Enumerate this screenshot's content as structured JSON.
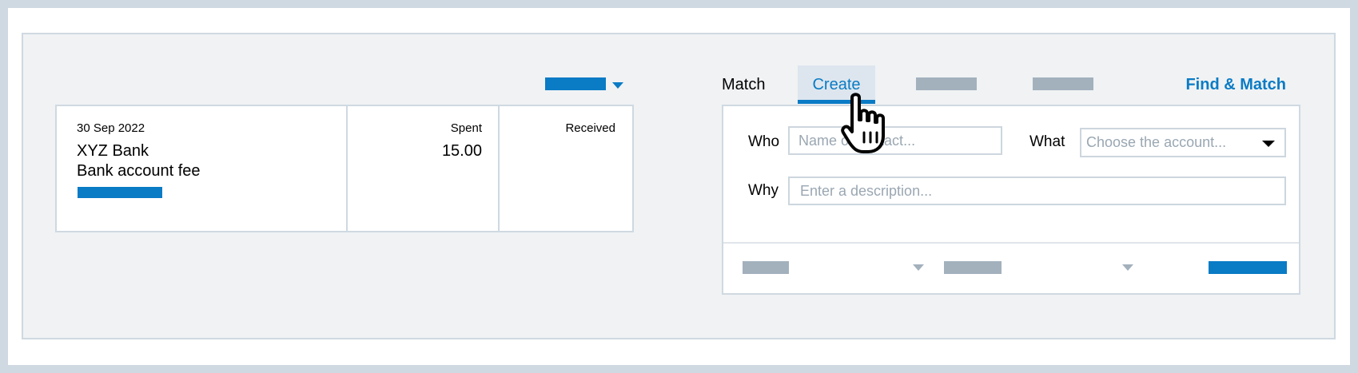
{
  "statement": {
    "date": "30 Sep 2022",
    "payee": "XYZ Bank",
    "reference": "Bank account fee",
    "spent_header": "Spent",
    "spent_value": "15.00",
    "received_header": "Received"
  },
  "tabs": {
    "match": "Match",
    "create": "Create",
    "find_match": "Find & Match",
    "active": "Create"
  },
  "form": {
    "who_label": "Who",
    "who_placeholder": "Name of contact...",
    "what_label": "What",
    "what_placeholder": "Choose the account...",
    "why_label": "Why",
    "why_placeholder": "Enter a description..."
  },
  "icons": {
    "options_caret": "caret-down-icon",
    "account_dropdown": "chevron-down-icon",
    "cursor": "hand-pointer-icon"
  },
  "colors": {
    "accent": "#0a7bc5",
    "placeholder_bar": "#a3b1bd",
    "panel_bg": "#f0f2f4",
    "border": "#cfd9e1"
  }
}
